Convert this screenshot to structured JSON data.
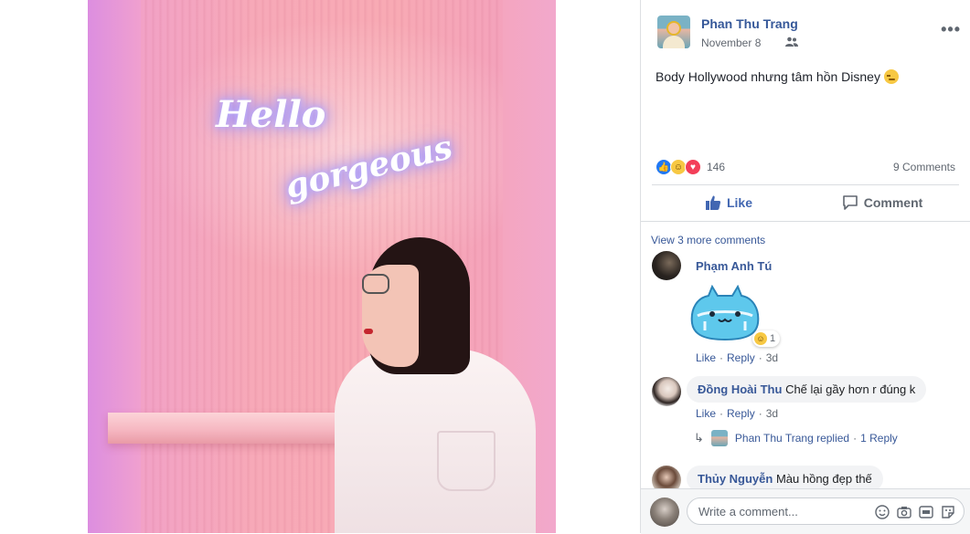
{
  "post": {
    "author": "Phan Thu Trang",
    "date": "November 8",
    "text": "Body Hollywood nhưng tâm hồn Disney",
    "reaction_count": "146",
    "comment_count": "9 Comments"
  },
  "photo": {
    "neon_line1": "Hello",
    "neon_line2": "gorgeous"
  },
  "actions": {
    "like": "Like",
    "comment": "Comment"
  },
  "comments": {
    "view_more": "View 3 more comments",
    "items": [
      {
        "name": "Phạm Anh Tú",
        "text": "",
        "sticker_reaction_count": "1",
        "like": "Like",
        "reply": "Reply",
        "time": "3d"
      },
      {
        "name": "Đồng Hoài Thu",
        "text": "Chế lại gầy hơn r đúng k",
        "like": "Like",
        "reply": "Reply",
        "time": "3d",
        "replied_by": "Phan Thu Trang replied",
        "reply_count": "1 Reply"
      },
      {
        "name": "Thủy Nguyễn",
        "text": "Màu hồng đẹp thế"
      }
    ]
  },
  "composer": {
    "placeholder": "Write a comment..."
  },
  "colors": {
    "link": "#385898",
    "like_blue": "#4267b2",
    "secondary_text": "#606770"
  }
}
